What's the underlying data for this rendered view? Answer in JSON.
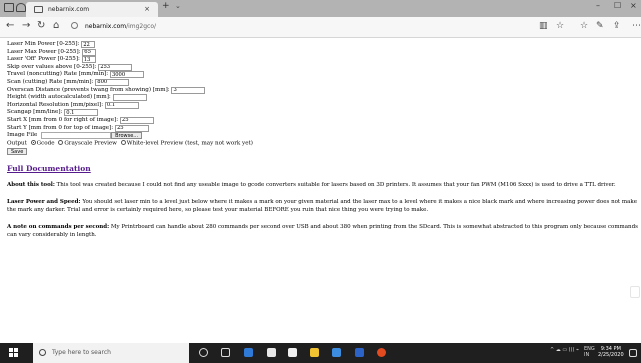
{
  "browser": {
    "tab_title": "nebarnix.com",
    "tab_close": "×",
    "new_tab": "+",
    "tab_dropdown": "⌄",
    "url_host": "nebarnix.com",
    "url_path": "/img2gco/",
    "minimize": "–",
    "maximize": "☐",
    "close": "×",
    "back": "←",
    "forward": "→",
    "refresh": "↻",
    "home": "⌂"
  },
  "form": {
    "laser_min": {
      "label": "Laser Min Power [0-255]:",
      "value": "22"
    },
    "laser_max": {
      "label": "Laser Max Power [0-255]:",
      "value": "65"
    },
    "laser_off": {
      "label": "Laser 'Off' Power [0-255]:",
      "value": "13"
    },
    "skip_over": {
      "label": "Skip over values above [0-255]:",
      "value": "253"
    },
    "travel_rate": {
      "label": "Travel (noncutting) Rate [mm/min]:",
      "value": "3000"
    },
    "scan_rate": {
      "label": "Scan (cutting) Rate [mm/min]:",
      "value": "800"
    },
    "overscan": {
      "label": "Overscan Distance (prevents twang from showing) [mm]:",
      "value": "3"
    },
    "height": {
      "label": "Height (width autocalculated) [mm]:",
      "value": ""
    },
    "h_resolution": {
      "label": "Horizontal Resolution [mm/pixel]:",
      "value": "0.1"
    },
    "scangap": {
      "label": "Scangap [mm/line]:",
      "value": "0.1"
    },
    "start_x": {
      "label": "Start X [mm from 0 for right of image]:",
      "value": "25"
    },
    "start_y": {
      "label": "Start Y [mm from 0 for top of image]:",
      "value": "25"
    },
    "image_file": {
      "label": "Image File",
      "browse": "Browse..."
    },
    "output": {
      "label": "Output",
      "options": [
        "Gcode",
        "Grayscale Preview",
        "White-level Preview (test, may not work yet)"
      ],
      "selected": "Gcode"
    },
    "save": "Save"
  },
  "docs": {
    "link": "Full Documentation",
    "about_title": "About this tool:",
    "about_text": "This tool was created because I could not find any useable image to gcode converters suitable for lasers based on 3D printers. It assumes that your fan PWM (M106 Sxxx) is used to drive a TTL driver.",
    "power_title": "Laser Power and Speed:",
    "power_text": "You should set laser min to a level just below where it makes a mark on your given material and the laser max to a level where it makes a nice black mark and where increasing power does not make the mark any darker. Trial and error is certainly required here, so please test your material BEFORE you ruin that nice thing you were trying to make.",
    "note_title": "A note on commands per second:",
    "note_text": "My Printrboard can handle about 280 commands per second over USB and about 380 when printing from the SDcard. This is somewhat abstracted to this program only because commands can vary considerably in length."
  },
  "taskbar": {
    "search_placeholder": "Type here to search",
    "lang": "ENG",
    "lang2": "IN",
    "time": "9:34 PM",
    "date": "2/25/2020",
    "tray_text": "^ ☁ ▭ ((( ⌁"
  },
  "colors": {
    "link": "#551a8b",
    "taskbar": "#1f1f1f",
    "tabbar": "#b3b3b3"
  }
}
